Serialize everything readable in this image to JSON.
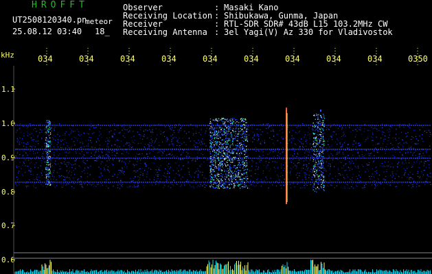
{
  "header": {
    "logo": "HROFFT",
    "filename": "UT2508120340.pn",
    "tag": "meteor",
    "datetime": "25.08.12 03:40",
    "count": "18_"
  },
  "info": [
    {
      "label": "Observer",
      "value": "Masaki Kano"
    },
    {
      "label": "Receiving Location",
      "value": "Shibukawa, Gunma, Japan"
    },
    {
      "label": "Receiver",
      "value": "RTL-SDR SDR# 43dB L15 103.2MHz CW"
    },
    {
      "label": "Receiving Antenna",
      "value": "3el Yagi(V) Az 330 for Vladivostok"
    }
  ],
  "axis": {
    "unit": "kHz",
    "time_labels": [
      "034",
      "034",
      "034",
      "034",
      "034",
      "034",
      "034",
      "034",
      "034",
      "0350"
    ],
    "freq_labels": [
      "1.1",
      "1.0",
      "0.9",
      "0.8",
      "0.7",
      "0.6"
    ]
  },
  "colors": {
    "background": "#000000",
    "logo": "#19c319",
    "axis_text": "#ffff66",
    "spectrogram": "#1a2fff",
    "baseline": "#00e0ff"
  }
}
